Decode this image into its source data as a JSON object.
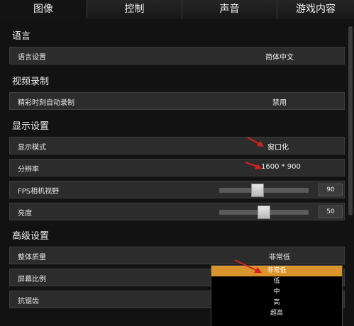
{
  "tabs": [
    "图像",
    "控制",
    "声音",
    "游戏内容"
  ],
  "sections": {
    "language": "语言",
    "video_record": "视频录制",
    "display": "显示设置",
    "advanced": "高级设置"
  },
  "rows": {
    "language_setting": {
      "label": "语言设置",
      "value": "简体中文"
    },
    "highlight_record": {
      "label": "精彩时刻自动录制",
      "value": "禁用"
    },
    "display_mode": {
      "label": "显示模式",
      "value": "窗口化"
    },
    "resolution": {
      "label": "分辨率",
      "value": "1600 * 900"
    },
    "fps_fov": {
      "label": "FPS相机视野",
      "value": "90",
      "fraction": 0.43
    },
    "brightness": {
      "label": "亮度",
      "value": "50",
      "fraction": 0.5
    },
    "overall_quality": {
      "label": "整体质量",
      "value": "非常低"
    },
    "screen_ratio": {
      "label": "屏幕比例"
    },
    "anti_aliasing": {
      "label": "抗锯齿"
    }
  },
  "quality_options": [
    "非常低",
    "低",
    "中",
    "高",
    "超高"
  ],
  "colors": {
    "accent": "#d9952b",
    "arrow": "#d62020"
  }
}
